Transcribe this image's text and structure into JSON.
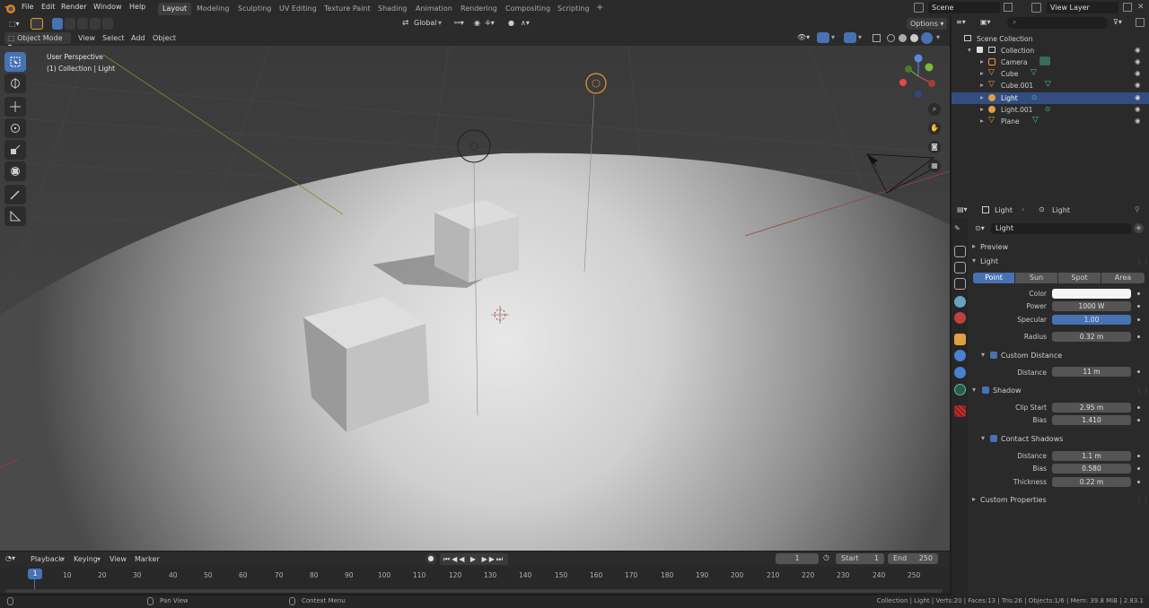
{
  "menu": {
    "items": [
      "File",
      "Edit",
      "Render",
      "Window",
      "Help"
    ],
    "workspaces": [
      "Layout",
      "Modeling",
      "Sculpting",
      "UV Editing",
      "Texture Paint",
      "Shading",
      "Animation",
      "Rendering",
      "Compositing",
      "Scripting"
    ],
    "active_workspace": "Layout",
    "add_tab": "+",
    "scene": "Scene",
    "view_layer": "View Layer"
  },
  "viewport_header": {
    "transform_orientation": "Global",
    "options": "Options",
    "mode": "Object Mode",
    "menus": [
      "View",
      "Select",
      "Add",
      "Object"
    ]
  },
  "viewport": {
    "perspective": "User Perspective",
    "collection_label": "(1) Collection | Light"
  },
  "outliner": {
    "root": "Scene Collection",
    "collection": "Collection",
    "items": [
      {
        "name": "Camera",
        "selected": false
      },
      {
        "name": "Cube",
        "selected": false
      },
      {
        "name": "Cube.001",
        "selected": false
      },
      {
        "name": "Light",
        "selected": true
      },
      {
        "name": "Light.001",
        "selected": false
      },
      {
        "name": "Plane",
        "selected": false
      }
    ]
  },
  "properties": {
    "breadcrumb_object": "Light",
    "breadcrumb_data": "Light",
    "data_name": "Light",
    "preview_label": "Preview",
    "light_label": "Light",
    "light_types": [
      "Point",
      "Sun",
      "Spot",
      "Area"
    ],
    "active_type": "Point",
    "color_label": "Color",
    "power_label": "Power",
    "power_value": "1000 W",
    "specular_label": "Specular",
    "specular_value": "1.00",
    "radius_label": "Radius",
    "radius_value": "0.32 m",
    "custom_distance_label": "Custom Distance",
    "distance_label": "Distance",
    "distance_value": "11 m",
    "shadow_label": "Shadow",
    "clip_start_label": "Clip Start",
    "clip_start_value": "2.95 m",
    "bias_label": "Bias",
    "bias_value": "1.410",
    "contact_shadows_label": "Contact Shadows",
    "cs_distance_label": "Distance",
    "cs_distance_value": "1.1 m",
    "cs_bias_label": "Bias",
    "cs_bias_value": "0.580",
    "cs_thickness_label": "Thickness",
    "cs_thickness_value": "0.22 m",
    "custom_properties_label": "Custom Properties"
  },
  "timeline": {
    "menus": [
      "Playback",
      "Keying",
      "View",
      "Marker"
    ],
    "current_frame": "1",
    "start_label": "Start",
    "start_value": "1",
    "end_label": "End",
    "end_value": "250",
    "ticks": [
      "10",
      "20",
      "30",
      "40",
      "50",
      "60",
      "70",
      "80",
      "90",
      "100",
      "110",
      "120",
      "130",
      "140",
      "150",
      "160",
      "170",
      "180",
      "190",
      "200",
      "210",
      "220",
      "230",
      "240",
      "250"
    ],
    "playhead_label": "1"
  },
  "statusbar": {
    "pan_view": "Pan View",
    "context_menu": "Context Menu",
    "stats": "Collection | Light | Verts:20 | Faces:13 | Tris:26 | Objects:1/6 | Mem: 39.8 MiB | 2.83.1"
  },
  "colors": {
    "accent": "#4772b3",
    "selected_row": "#334d80",
    "panel": "#2a2a2a",
    "header": "#2b2b2b"
  }
}
